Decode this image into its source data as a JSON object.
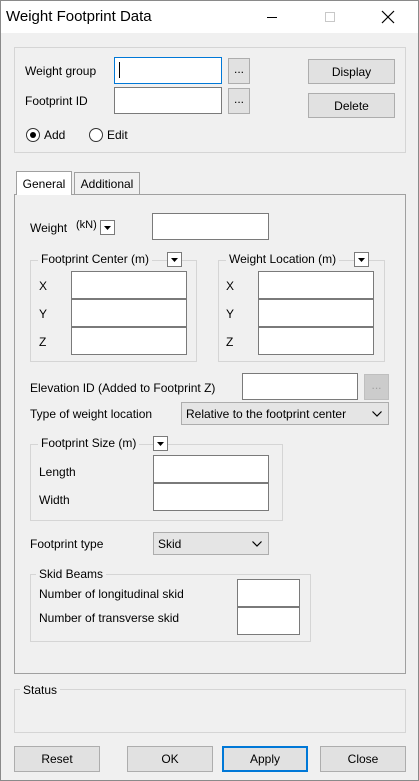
{
  "window": {
    "title": "Weight Footprint Data"
  },
  "top": {
    "weight_group_label": "Weight group",
    "weight_group_value": "",
    "footprint_id_label": "Footprint ID",
    "footprint_id_value": "",
    "ellipsis": "...",
    "display_button": "Display",
    "delete_button": "Delete",
    "add_label": "Add",
    "edit_label": "Edit",
    "mode_selected": "Add"
  },
  "tabs": [
    {
      "label": "General",
      "active": true
    },
    {
      "label": "Additional",
      "active": false
    }
  ],
  "general": {
    "weight_label": "Weight",
    "weight_unit": "(kN)",
    "weight_value": "",
    "footprint_center": {
      "title": "Footprint Center (m)",
      "x_label": "X",
      "y_label": "Y",
      "z_label": "Z",
      "x": "",
      "y": "",
      "z": ""
    },
    "weight_location": {
      "title": "Weight Location (m)",
      "x_label": "X",
      "y_label": "Y",
      "z_label": "Z",
      "x": "",
      "y": "",
      "z": ""
    },
    "elevation_label": "Elevation ID (Added to Footprint Z)",
    "elevation_value": "",
    "elevation_ellipsis": "...",
    "type_location_label": "Type of weight location",
    "type_location_value": "Relative to the footprint center",
    "footprint_size": {
      "title": "Footprint Size (m)",
      "length_label": "Length",
      "width_label": "Width",
      "length": "",
      "width": ""
    },
    "footprint_type_label": "Footprint type",
    "footprint_type_value": "Skid",
    "skid_beams": {
      "title": "Skid Beams",
      "longitudinal_label": "Number of longitudinal skid",
      "transverse_label": "Number of transverse skid",
      "longitudinal": "",
      "transverse": ""
    }
  },
  "status": {
    "title": "Status",
    "text": ""
  },
  "buttons": {
    "reset": "Reset",
    "ok": "OK",
    "apply": "Apply",
    "close": "Close"
  }
}
